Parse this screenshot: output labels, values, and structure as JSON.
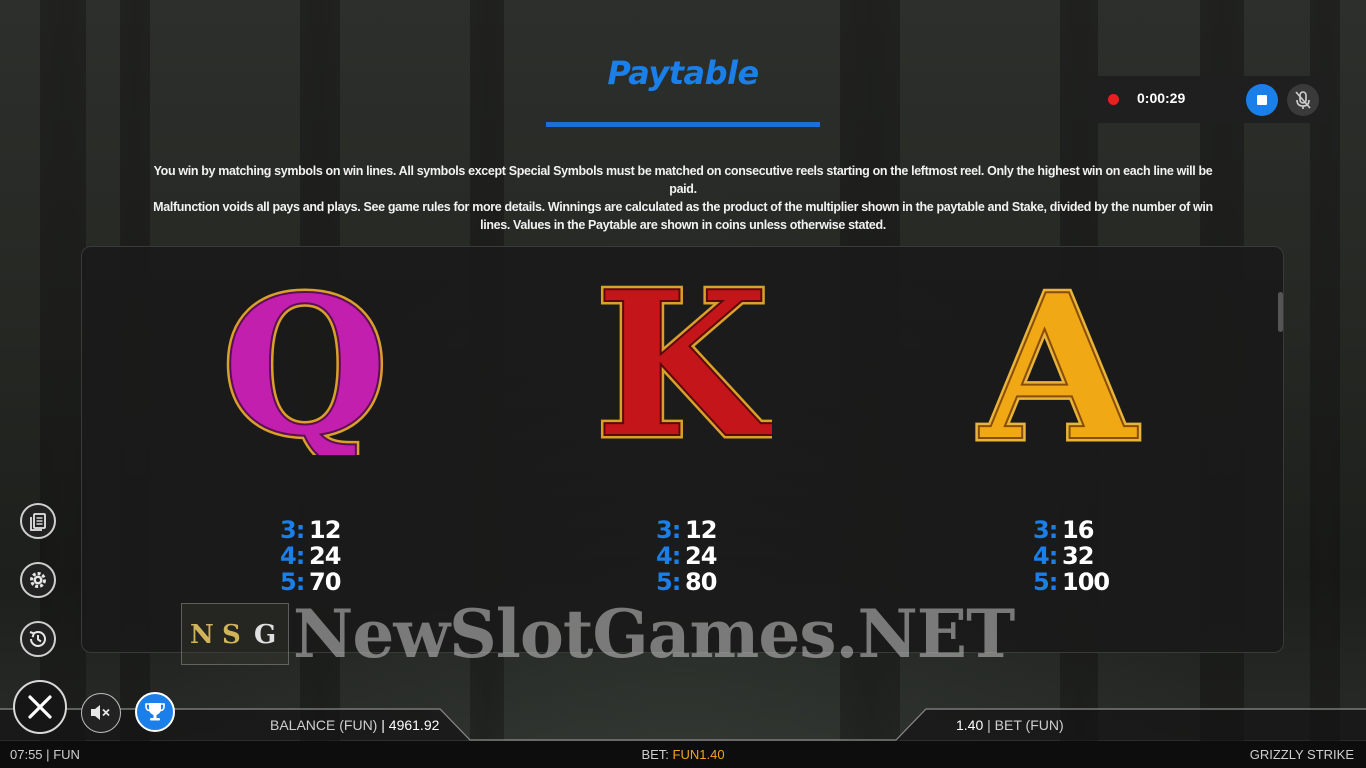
{
  "header": {
    "title": "Paytable",
    "intro_line1": "You win by matching symbols on win lines. All symbols except Special Symbols must be matched on consecutive reels starting on the leftmost reel. Only the highest win on each line will be paid.",
    "intro_line2": "Malfunction voids all pays and plays. See game rules for more details. Winnings are calculated as the product of the multiplier shown in the paytable and Stake, divided by the number of win",
    "intro_line3": "lines. Values in the Paytable are shown in coins unless otherwise stated."
  },
  "recorder": {
    "time": "0:00:29"
  },
  "symbols": [
    {
      "name": "Q",
      "color": "#c21fae",
      "pays": [
        {
          "k": "3:",
          "v": "12"
        },
        {
          "k": "4:",
          "v": "24"
        },
        {
          "k": "5:",
          "v": "70"
        }
      ]
    },
    {
      "name": "K",
      "color": "#c4151a",
      "pays": [
        {
          "k": "3:",
          "v": "12"
        },
        {
          "k": "4:",
          "v": "24"
        },
        {
          "k": "5:",
          "v": "80"
        }
      ]
    },
    {
      "name": "A",
      "color": "#f0a915",
      "pays": [
        {
          "k": "3:",
          "v": "16"
        },
        {
          "k": "4:",
          "v": "32"
        },
        {
          "k": "5:",
          "v": "100"
        }
      ]
    }
  ],
  "watermark": {
    "logo_n": "N",
    "logo_s": "S",
    "logo_g": "G",
    "text": "NewSlotGames.NET"
  },
  "footer": {
    "balance_label": "BALANCE (FUN)",
    "balance_sep": "|",
    "balance_value": "4961.92",
    "bet_value": "1.40",
    "bet_sep": "|",
    "bet_label": "BET",
    "bet_unit": "(FUN)",
    "clock": "07:55",
    "mode": "FUN",
    "center_label": "BET:",
    "center_amount": "FUN1.40",
    "game_name": "GRIZZLY STRIKE"
  },
  "colors": {
    "accent": "#1a7fe8",
    "bet_amount": "#f2a51a"
  }
}
